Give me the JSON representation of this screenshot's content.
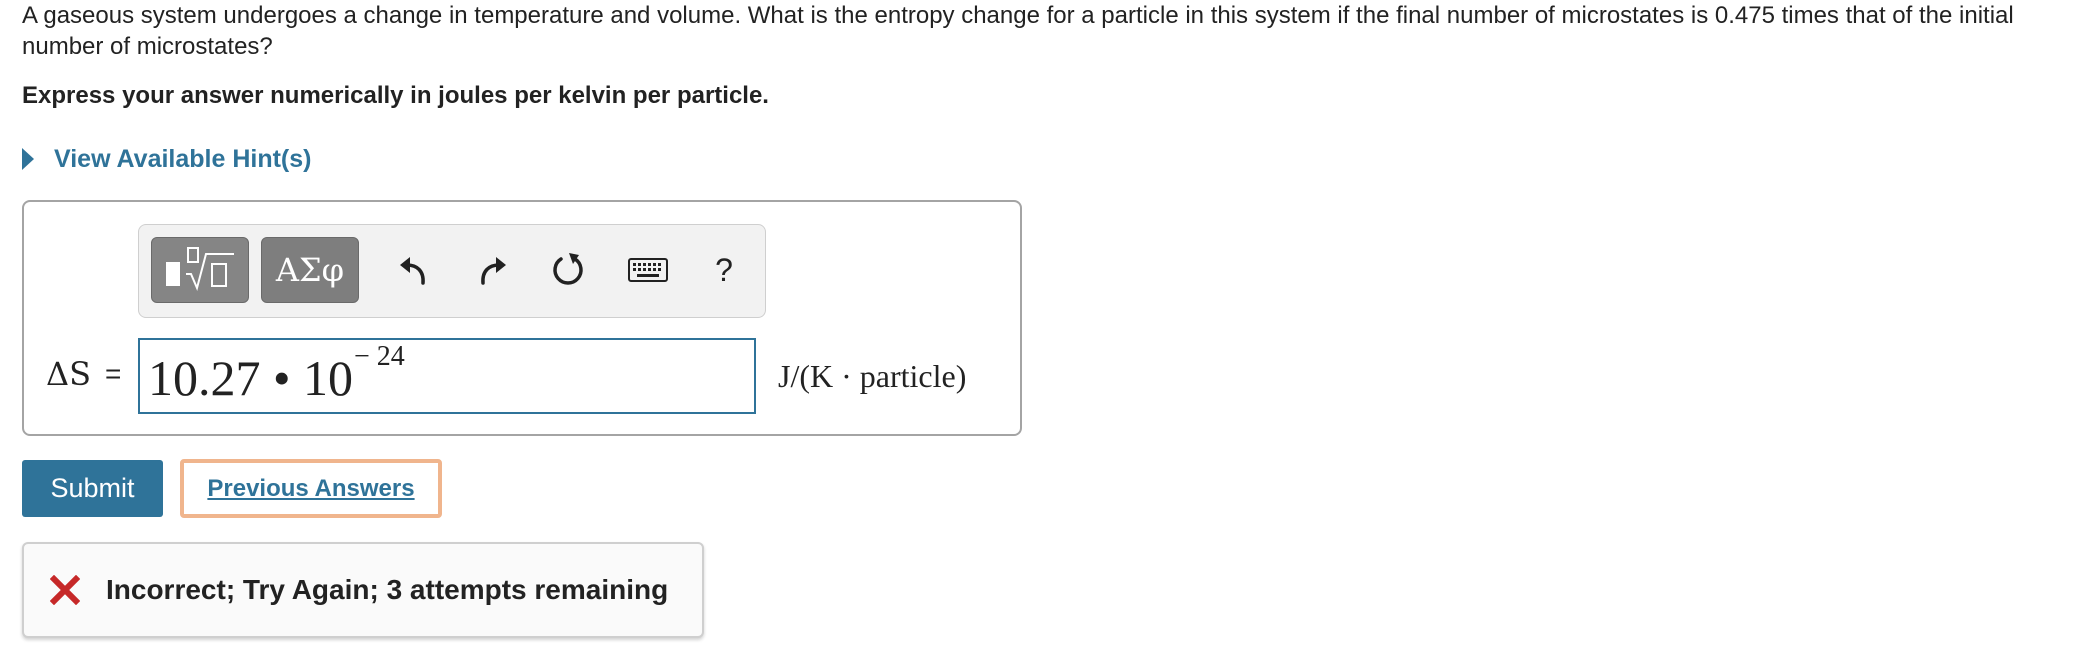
{
  "question": {
    "text": "A gaseous system undergoes a change in temperature and volume. What is the entropy change for a particle in this system if the final number of microstates is 0.475 times that of the initial number of microstates?",
    "instruction": "Express your answer numerically in joules per kelvin per particle."
  },
  "hints": {
    "label": "View Available Hint(s)"
  },
  "toolbar": {
    "templates_icon": "templates-radical-icon",
    "greek_label": "ΑΣφ",
    "undo_icon": "undo-icon",
    "redo_icon": "redo-icon",
    "reset_icon": "reset-icon",
    "keyboard_icon": "keyboard-icon",
    "help_label": "?"
  },
  "answer": {
    "variable": "ΔS",
    "equals": "=",
    "value_main": "10.27 • 10",
    "value_exponent": "− 24",
    "units": "J/(K · particle)"
  },
  "buttons": {
    "submit_label": "Submit",
    "previous_answers_label": "Previous Answers"
  },
  "feedback": {
    "icon": "x-icon",
    "message": "Incorrect; Try Again; 3 attempts remaining",
    "icon_color": "#c62828"
  },
  "colors": {
    "accent": "#2f7399",
    "highlight_border": "#f0b58d"
  }
}
